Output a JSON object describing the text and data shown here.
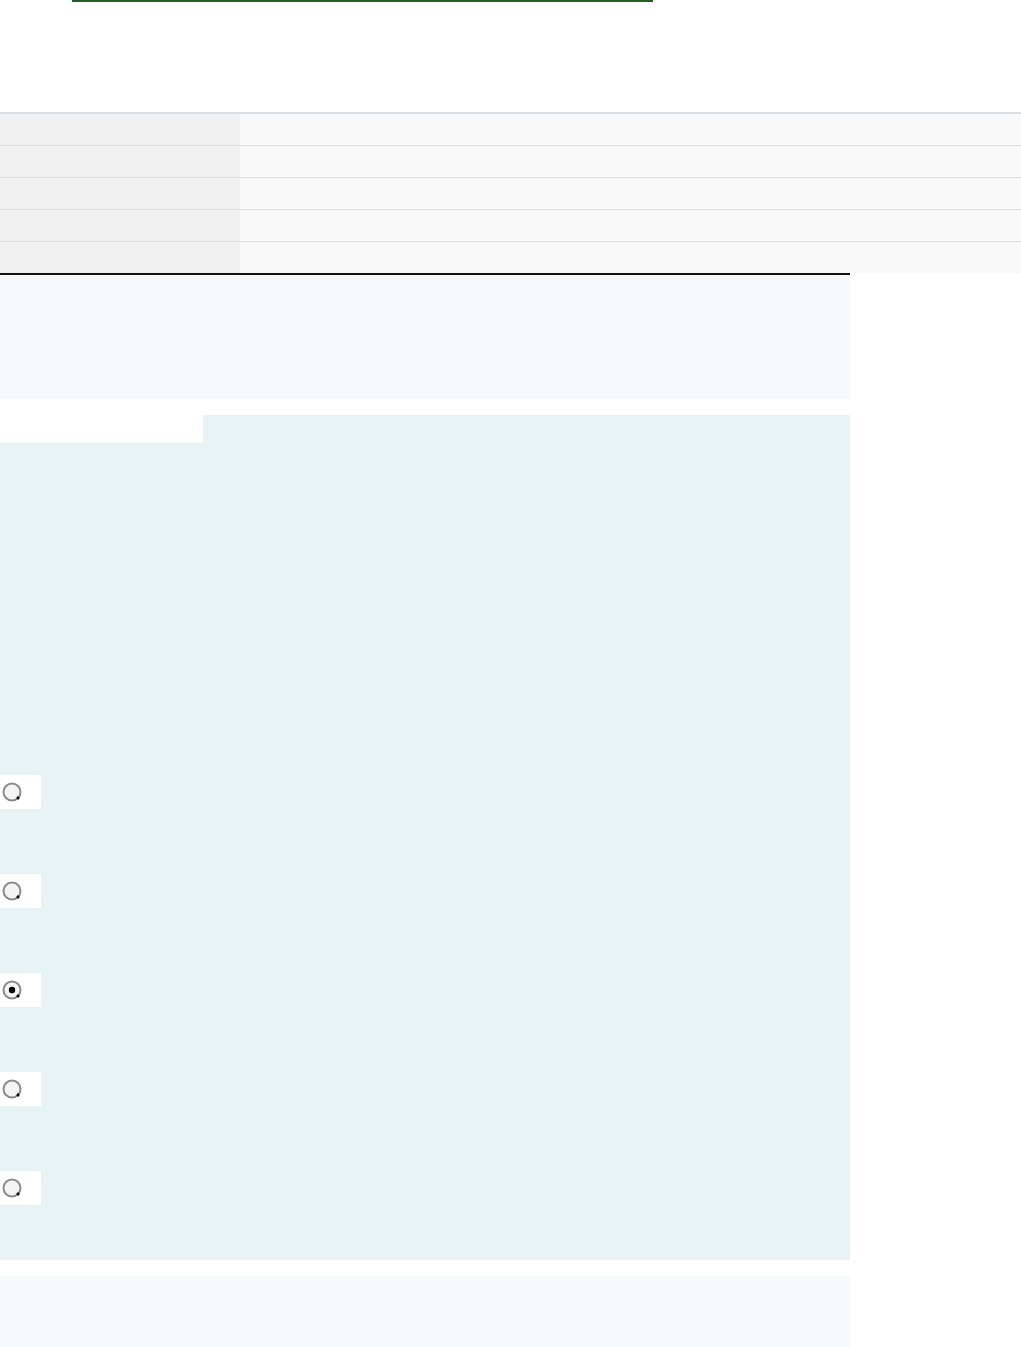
{
  "question": {
    "options": [
      {
        "selected": false
      },
      {
        "selected": false
      },
      {
        "selected": true
      },
      {
        "selected": false
      },
      {
        "selected": false
      }
    ]
  }
}
